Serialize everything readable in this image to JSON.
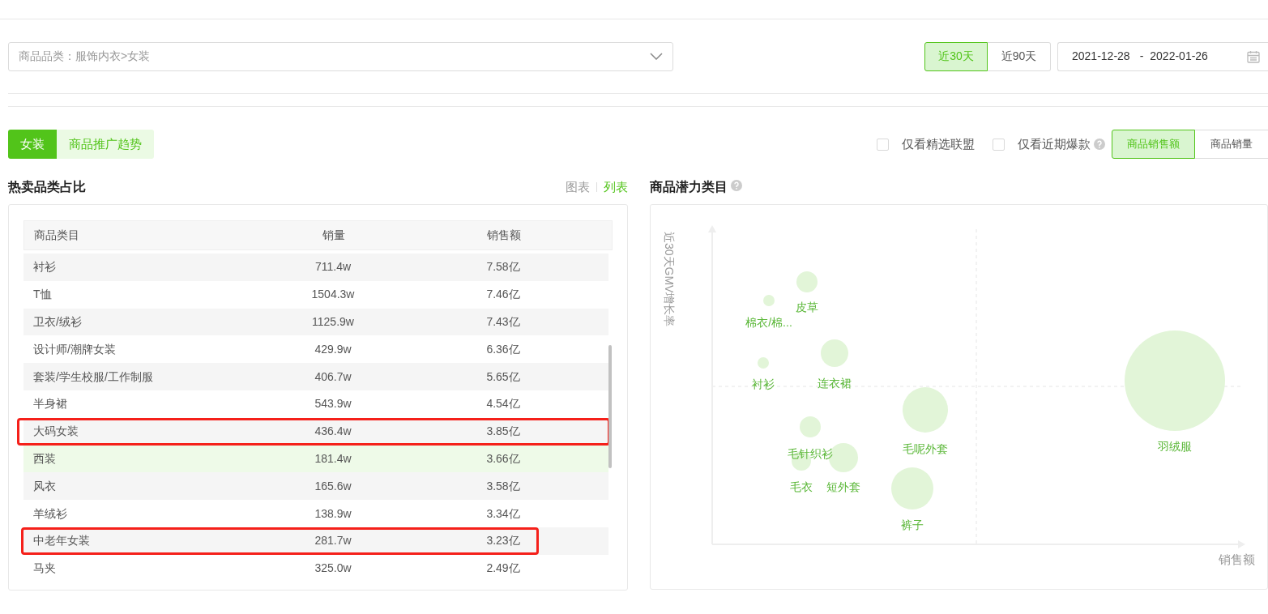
{
  "category_select": {
    "value": "商品品类：服饰内衣>女装"
  },
  "period_buttons": [
    {
      "label": "近30天",
      "selected": true
    },
    {
      "label": "近90天",
      "selected": false
    }
  ],
  "date_range": {
    "start": "2021-12-28",
    "separator": "-",
    "end": "2022-01-26"
  },
  "tabs": [
    {
      "label": "女装",
      "selected": true
    },
    {
      "label": "商品推广趋势",
      "selected": false
    }
  ],
  "filters": [
    {
      "label": "仅看精选联盟",
      "checked": false,
      "help": false
    },
    {
      "label": "仅看近期爆款",
      "checked": false,
      "help": true
    }
  ],
  "metric_buttons": [
    {
      "label": "商品销售额",
      "selected": true
    },
    {
      "label": "商品销量",
      "selected": false
    }
  ],
  "hot_categories": {
    "title": "热卖品类占比",
    "views": [
      {
        "label": "图表",
        "selected": false
      },
      {
        "label": "列表",
        "selected": true
      }
    ],
    "table": {
      "columns": [
        "商品类目",
        "销量",
        "销售额"
      ],
      "rows": [
        {
          "cells": [
            "衬衫",
            "711.4w",
            "7.58亿"
          ],
          "hovered": false,
          "highlighted": false
        },
        {
          "cells": [
            "T恤",
            "1504.3w",
            "7.46亿"
          ],
          "hovered": false,
          "highlighted": false
        },
        {
          "cells": [
            "卫衣/绒衫",
            "1125.9w",
            "7.43亿"
          ],
          "hovered": false,
          "highlighted": false
        },
        {
          "cells": [
            "设计师/潮牌女装",
            "429.9w",
            "6.36亿"
          ],
          "hovered": false,
          "highlighted": false
        },
        {
          "cells": [
            "套装/学生校服/工作制服",
            "406.7w",
            "5.65亿"
          ],
          "hovered": false,
          "highlighted": false
        },
        {
          "cells": [
            "半身裙",
            "543.9w",
            "4.54亿"
          ],
          "hovered": false,
          "highlighted": false
        },
        {
          "cells": [
            "大码女装",
            "436.4w",
            "3.85亿"
          ],
          "hovered": false,
          "highlighted": true
        },
        {
          "cells": [
            "西装",
            "181.4w",
            "3.66亿"
          ],
          "hovered": true,
          "highlighted": false
        },
        {
          "cells": [
            "风衣",
            "165.6w",
            "3.58亿"
          ],
          "hovered": false,
          "highlighted": false
        },
        {
          "cells": [
            "羊绒衫",
            "138.9w",
            "3.34亿"
          ],
          "hovered": false,
          "highlighted": false
        },
        {
          "cells": [
            "中老年女装",
            "281.7w",
            "3.23亿"
          ],
          "hovered": false,
          "highlighted": true
        },
        {
          "cells": [
            "马夹",
            "325.0w",
            "2.49亿"
          ],
          "hovered": false,
          "highlighted": false
        }
      ]
    }
  },
  "potential": {
    "title": "商品潜力类目",
    "help": true,
    "chart": {
      "y_axis_label": "近30天GMV增长率",
      "x_axis_label": "销售额",
      "bubbles": [
        {
          "label": "皮草"
        },
        {
          "label": "棉衣/棉..."
        },
        {
          "label": "连衣裙"
        },
        {
          "label": "衬衫"
        },
        {
          "label": "毛呢外套"
        },
        {
          "label": "羽绒服"
        },
        {
          "label": "毛针织衫"
        },
        {
          "label": "毛衣"
        },
        {
          "label": "短外套"
        },
        {
          "label": "裤子"
        }
      ]
    }
  }
}
